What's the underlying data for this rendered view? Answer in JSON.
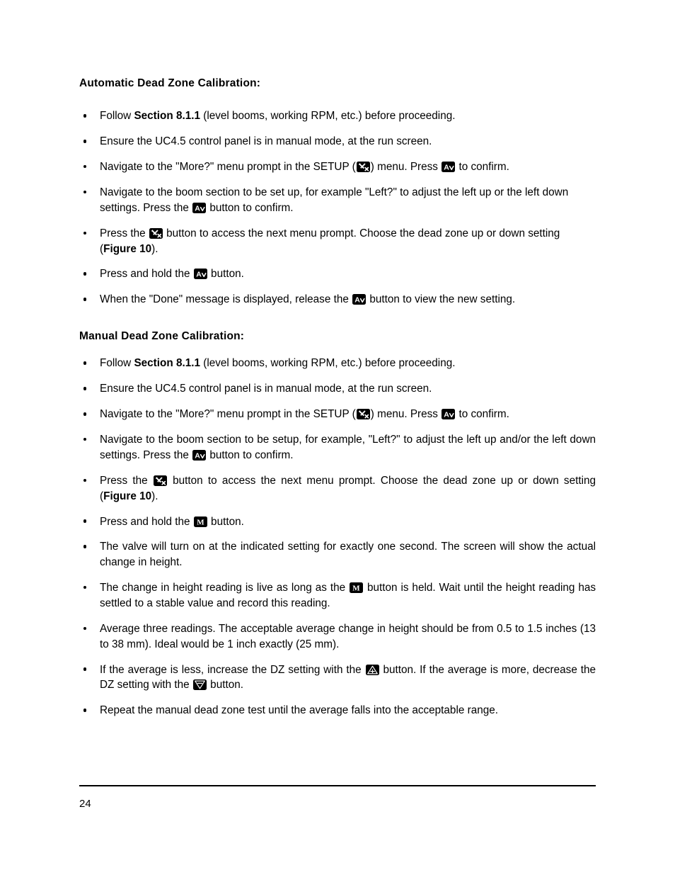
{
  "document": {
    "page_number": "24"
  },
  "sections": [
    {
      "heading": "Automatic Dead Zone Calibration:",
      "bullets": [
        {
          "parts": [
            {
              "t": "text",
              "v": "Follow "
            },
            {
              "t": "bold",
              "v": "Section 8.1.1"
            },
            {
              "t": "text",
              "v": " (level booms, working RPM, etc.) before proceeding."
            }
          ]
        },
        {
          "parts": [
            {
              "t": "text",
              "v": "Ensure the UC4.5 control panel is in manual mode, at the run screen."
            }
          ]
        },
        {
          "parts": [
            {
              "t": "text",
              "v": "Navigate to the \"More?\" menu prompt in the SETUP ("
            },
            {
              "t": "icon",
              "v": "setup-wrench-icon"
            },
            {
              "t": "text",
              "v": ") menu. Press "
            },
            {
              "t": "icon",
              "v": "a-down-button-icon"
            },
            {
              "t": "text",
              "v": " to confirm."
            }
          ]
        },
        {
          "parts": [
            {
              "t": "text",
              "v": "Navigate to the boom section to be set up, for example \"Left?\" to adjust the left up or the left down settings.  Press the "
            },
            {
              "t": "icon",
              "v": "a-down-button-icon"
            },
            {
              "t": "text",
              "v": " button to confirm."
            }
          ]
        },
        {
          "parts": [
            {
              "t": "text",
              "v": "Press the "
            },
            {
              "t": "icon",
              "v": "setup-wrench-icon"
            },
            {
              "t": "text",
              "v": " button to access the next menu prompt.  Choose the dead zone up or down setting ("
            },
            {
              "t": "bold",
              "v": "Figure 10"
            },
            {
              "t": "text",
              "v": ")."
            }
          ]
        },
        {
          "parts": [
            {
              "t": "text",
              "v": "Press and hold the "
            },
            {
              "t": "icon",
              "v": "a-down-button-icon"
            },
            {
              "t": "text",
              "v": " button."
            }
          ]
        },
        {
          "parts": [
            {
              "t": "text",
              "v": "When the \"Done\" message is displayed, release the "
            },
            {
              "t": "icon",
              "v": "a-down-button-icon"
            },
            {
              "t": "text",
              "v": " button to view the new setting."
            }
          ]
        }
      ]
    },
    {
      "heading": "Manual Dead Zone Calibration:",
      "bullets": [
        {
          "parts": [
            {
              "t": "text",
              "v": "Follow "
            },
            {
              "t": "bold",
              "v": "Section 8.1.1"
            },
            {
              "t": "text",
              "v": " (level booms, working RPM, etc.) before proceeding."
            }
          ]
        },
        {
          "parts": [
            {
              "t": "text",
              "v": "Ensure the UC4.5 control panel is in manual mode, at the run screen."
            }
          ]
        },
        {
          "parts": [
            {
              "t": "text",
              "v": "Navigate to the \"More?\" menu prompt in the SETUP ("
            },
            {
              "t": "icon",
              "v": "setup-wrench-icon"
            },
            {
              "t": "text",
              "v": ") menu. Press "
            },
            {
              "t": "icon",
              "v": "a-down-button-icon"
            },
            {
              "t": "text",
              "v": " to confirm."
            }
          ]
        },
        {
          "justify": true,
          "parts": [
            {
              "t": "text",
              "v": "Navigate to the boom section to be setup, for example, \"Left?\" to adjust the left up and/or the left down settings.  Press the "
            },
            {
              "t": "icon",
              "v": "a-down-button-icon"
            },
            {
              "t": "text",
              "v": " button to confirm."
            }
          ]
        },
        {
          "justify": true,
          "parts": [
            {
              "t": "text",
              "v": "Press the "
            },
            {
              "t": "icon",
              "v": "setup-wrench-icon"
            },
            {
              "t": "text",
              "v": " button to access the next menu prompt.  Choose the dead zone up or down setting ("
            },
            {
              "t": "bold",
              "v": "Figure 10"
            },
            {
              "t": "text",
              "v": ")."
            }
          ]
        },
        {
          "parts": [
            {
              "t": "text",
              "v": "Press and hold the "
            },
            {
              "t": "icon",
              "v": "m-button-icon"
            },
            {
              "t": "text",
              "v": " button."
            }
          ]
        },
        {
          "justify": true,
          "parts": [
            {
              "t": "text",
              "v": "The valve will turn on at the indicated setting for exactly one second.  The screen will show the actual change in height."
            }
          ]
        },
        {
          "justify": true,
          "parts": [
            {
              "t": "text",
              "v": "The change in height reading is live as long as the "
            },
            {
              "t": "icon",
              "v": "m-button-icon"
            },
            {
              "t": "text",
              "v": " button is held.  Wait until the height reading has settled to a stable value and record this reading."
            }
          ]
        },
        {
          "justify": true,
          "parts": [
            {
              "t": "text",
              "v": "Average three readings.  The acceptable average change in height should be from 0.5 to 1.5 inches (13 to 38 mm).  Ideal would be 1 inch exactly (25 mm)."
            }
          ]
        },
        {
          "justify": true,
          "parts": [
            {
              "t": "text",
              "v": "If the average is less, increase the DZ setting with the "
            },
            {
              "t": "icon",
              "v": "triangle-up-button-icon"
            },
            {
              "t": "text",
              "v": " button. If the average is more, decrease the DZ setting with the "
            },
            {
              "t": "icon",
              "v": "triangle-down-button-icon"
            },
            {
              "t": "text",
              "v": " button."
            }
          ]
        },
        {
          "parts": [
            {
              "t": "text",
              "v": "Repeat the manual dead zone test until the average falls into the acceptable range."
            }
          ]
        }
      ]
    }
  ],
  "icons": {
    "setup-wrench-icon": "setup-wrench-icon",
    "a-down-button-icon": "a-down-button-icon",
    "m-button-icon": "m-button-icon",
    "triangle-up-button-icon": "triangle-up-button-icon",
    "triangle-down-button-icon": "triangle-down-button-icon"
  },
  "colors": {
    "ink": "#000000",
    "paper": "#ffffff"
  }
}
